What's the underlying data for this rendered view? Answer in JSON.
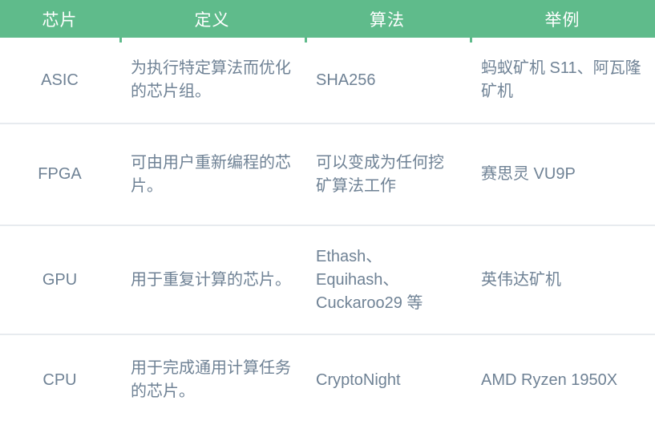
{
  "table": {
    "accent_color": "#5fbb8b",
    "header_text_color": "#ffffff",
    "body_text_color": "#6f8295",
    "divider_color": "#e7ebef",
    "columns": [
      {
        "key": "chip",
        "label": "芯片",
        "align": "center"
      },
      {
        "key": "definition",
        "label": "定义",
        "align": "left"
      },
      {
        "key": "algorithm",
        "label": "算法",
        "align": "left"
      },
      {
        "key": "example",
        "label": "举例",
        "align": "left"
      }
    ],
    "rows": [
      {
        "chip": "ASIC",
        "definition": "为执行特定算法而优化的芯片组。",
        "algorithm": "SHA256",
        "example": "蚂蚁矿机 S11、阿瓦隆矿机"
      },
      {
        "chip": "FPGA",
        "definition": "可由用户重新编程的芯片。",
        "algorithm": "可以变成为任何挖矿算法工作",
        "example": "赛思灵 VU9P"
      },
      {
        "chip": "GPU",
        "definition": "用于重复计算的芯片。",
        "algorithm": "Ethash、Equihash、Cuckaroo29 等",
        "example": "英伟达矿机"
      },
      {
        "chip": "CPU",
        "definition": "用于完成通用计算任务的芯片。",
        "algorithm": "CryptoNight",
        "example": "AMD Ryzen 1950X"
      }
    ]
  }
}
